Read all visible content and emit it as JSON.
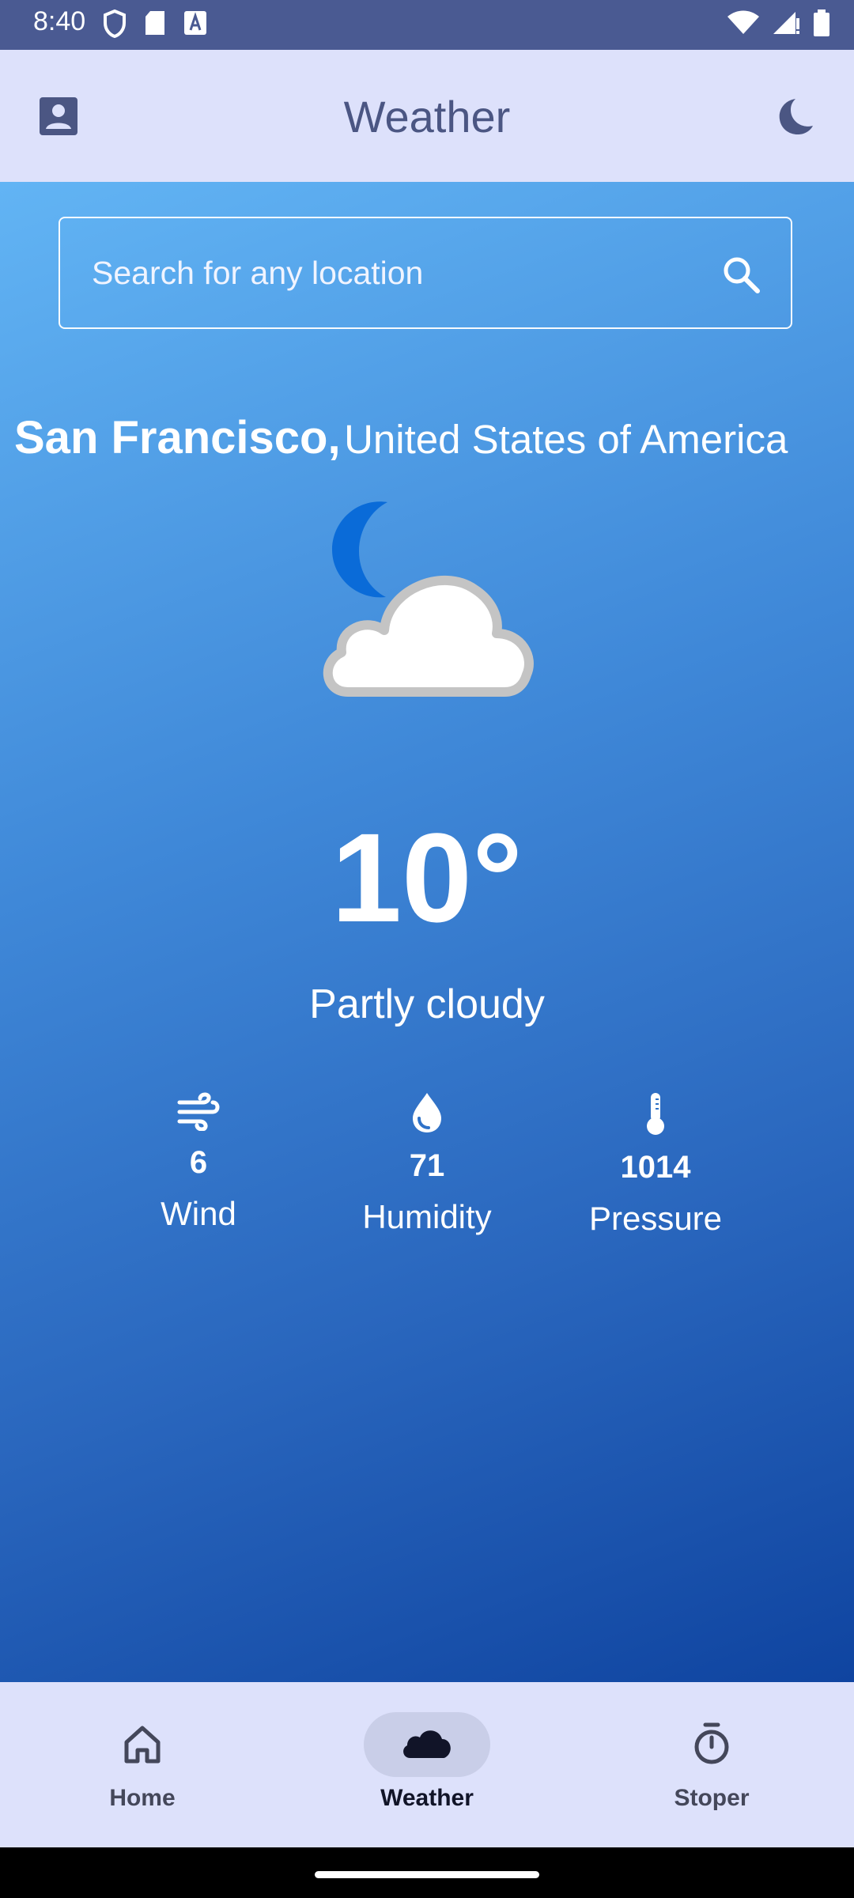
{
  "status_bar": {
    "time": "8:40"
  },
  "app_bar": {
    "title": "Weather"
  },
  "search": {
    "placeholder": "Search for any location"
  },
  "location": {
    "city": "San Francisco,",
    "country": "United States of America"
  },
  "current": {
    "temperature": "10°",
    "condition": "Partly cloudy",
    "icon": "partly-cloudy-night-icon"
  },
  "stats": [
    {
      "icon": "wind-icon",
      "value": "6",
      "label": "Wind"
    },
    {
      "icon": "humidity-drop-icon",
      "value": "71",
      "label": "Humidity"
    },
    {
      "icon": "thermometer-icon",
      "value": "1014",
      "label": "Pressure"
    }
  ],
  "bottom_nav": [
    {
      "icon": "home-icon",
      "label": "Home",
      "active": false
    },
    {
      "icon": "cloud-icon",
      "label": "Weather",
      "active": true
    },
    {
      "icon": "stopwatch-icon",
      "label": "Stoper",
      "active": false
    }
  ],
  "colors": {
    "status_bar_bg": "#4a5a92",
    "app_bar_bg": "#dde1fb",
    "gradient_top": "#62b4f4",
    "gradient_bottom": "#0f44a0",
    "moon_blue": "#0a6bd8"
  }
}
